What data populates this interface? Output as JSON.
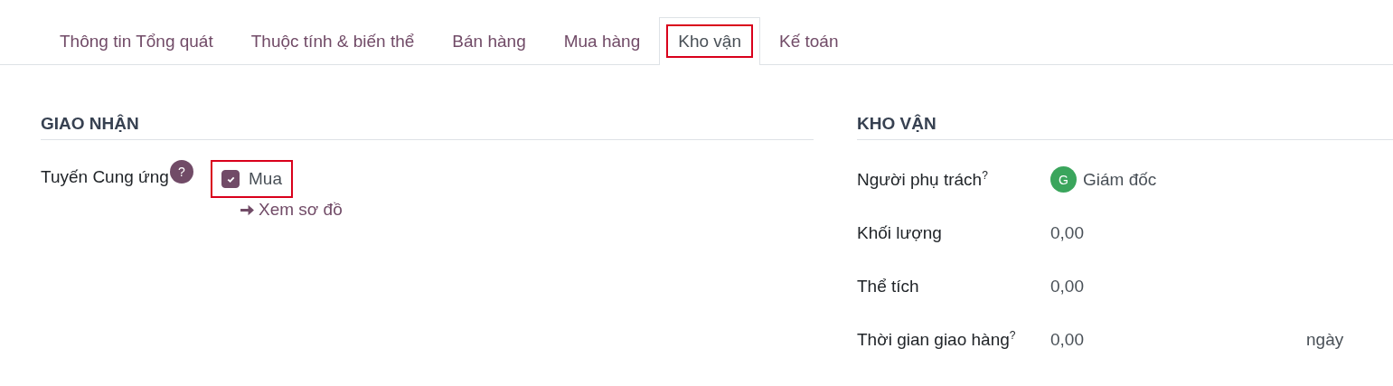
{
  "tabs": [
    {
      "label": "Thông tin Tổng quát",
      "selected": false,
      "highlighted": false
    },
    {
      "label": "Thuộc tính & biến thể",
      "selected": false,
      "highlighted": false
    },
    {
      "label": "Bán hàng",
      "selected": false,
      "highlighted": false
    },
    {
      "label": "Mua hàng",
      "selected": false,
      "highlighted": false
    },
    {
      "label": "Kho vận",
      "selected": true,
      "highlighted": true
    },
    {
      "label": "Kế toán",
      "selected": false,
      "highlighted": false
    }
  ],
  "delivery": {
    "title": "GIAO NHẬN",
    "label": "Tuyến Cung ứng",
    "help": "?",
    "routes": [
      {
        "label": "Mua",
        "checked": true,
        "highlighted": true
      }
    ],
    "link": "Xem sơ đồ"
  },
  "logistics": {
    "title": "KHO VẬN",
    "fields": [
      {
        "kind": "user",
        "label": "Người phụ trách",
        "help": "?",
        "initial": "G",
        "color": "#3aa55c",
        "value": "Giám đốc"
      },
      {
        "kind": "number",
        "label": "Khối lượng",
        "value": "0,00"
      },
      {
        "kind": "number",
        "label": "Thể tích",
        "value": "0,00"
      },
      {
        "kind": "number",
        "label": "Thời gian giao hàng",
        "help": "?",
        "value": "0,00",
        "unit": "ngày"
      }
    ]
  }
}
